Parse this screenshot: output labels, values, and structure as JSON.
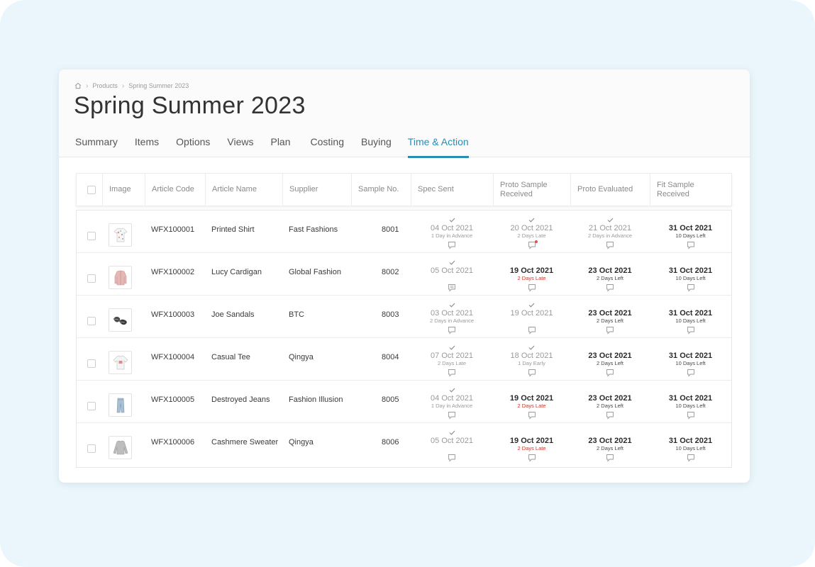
{
  "breadcrumb": [
    "Products",
    "Spring Summer 2023"
  ],
  "page_title": "Spring Summer 2023",
  "tabs": [
    {
      "label": "Summary",
      "active": false
    },
    {
      "label": "Items",
      "active": false
    },
    {
      "label": "Options",
      "active": false
    },
    {
      "label": "Views",
      "active": false
    },
    {
      "label": "Plan",
      "active": false
    },
    {
      "label": "Costing",
      "active": false
    },
    {
      "label": "Buying",
      "active": false
    },
    {
      "label": "Time & Action",
      "active": true
    }
  ],
  "columns": {
    "image": "Image",
    "article_code": "Article Code",
    "article_name": "Article Name",
    "supplier": "Supplier",
    "sample_no": "Sample No.",
    "spec_sent": "Spec Sent",
    "proto_received": "Proto Sample\nReceived",
    "proto_evaluated": "Proto Evaluated",
    "fit_received": "Fit Sample\nReceived"
  },
  "colors": {
    "accent": "#2a8cb5",
    "late": "#c0392b",
    "muted": "#9a9a9a"
  },
  "rows": [
    {
      "article_code": "WFX100001",
      "article_name": "Printed Shirt",
      "supplier": "Fast Fashions",
      "sample_no": "8001",
      "thumb_icon": "printed-shirt-icon",
      "spec": {
        "done": true,
        "date": "04 Oct 2021",
        "sub": "1 Day in Advance",
        "state": "done"
      },
      "proto": {
        "done": true,
        "date": "20 Oct 2021",
        "sub": "2 Days Late",
        "state": "done",
        "comment_alert": true
      },
      "eval": {
        "done": true,
        "date": "21 Oct 2021",
        "sub": "2 Days in Advance",
        "state": "done"
      },
      "fit": {
        "done": false,
        "date": "31 Oct 2021",
        "sub": "10 Days Left",
        "state": "pending"
      }
    },
    {
      "article_code": "WFX100002",
      "article_name": "Lucy Cardigan",
      "supplier": "Global Fashion",
      "sample_no": "8002",
      "thumb_icon": "cardigan-icon",
      "spec": {
        "done": true,
        "date": "05 Oct 2021",
        "sub": "",
        "state": "done"
      },
      "proto": {
        "done": false,
        "date": "19 Oct 2021",
        "sub": "2 Days Late",
        "state": "late"
      },
      "eval": {
        "done": false,
        "date": "23 Oct 2021",
        "sub": "2 Days Left",
        "state": "pending"
      },
      "fit": {
        "done": false,
        "date": "31 Oct 2021",
        "sub": "10 Days Left",
        "state": "pending"
      }
    },
    {
      "article_code": "WFX100003",
      "article_name": "Joe Sandals",
      "supplier": "BTC",
      "sample_no": "8003",
      "thumb_icon": "sandals-icon",
      "spec": {
        "done": true,
        "date": "03 Oct 2021",
        "sub": "2 Days in Advance",
        "state": "done"
      },
      "proto": {
        "done": true,
        "date": "19 Oct 2021",
        "sub": "",
        "state": "done"
      },
      "eval": {
        "done": false,
        "date": "23 Oct 2021",
        "sub": "2 Days Left",
        "state": "pending"
      },
      "fit": {
        "done": false,
        "date": "31 Oct 2021",
        "sub": "10 Days Left",
        "state": "pending"
      }
    },
    {
      "article_code": "WFX100004",
      "article_name": "Casual Tee",
      "supplier": "Qingya",
      "sample_no": "8004",
      "thumb_icon": "tee-icon",
      "spec": {
        "done": true,
        "date": "07 Oct 2021",
        "sub": "2 Days Late",
        "state": "done"
      },
      "proto": {
        "done": true,
        "date": "18 Oct 2021",
        "sub": "1 Day Early",
        "state": "done"
      },
      "eval": {
        "done": false,
        "date": "23 Oct 2021",
        "sub": "2 Days Left",
        "state": "pending"
      },
      "fit": {
        "done": false,
        "date": "31 Oct 2021",
        "sub": "10 Days Left",
        "state": "pending"
      }
    },
    {
      "article_code": "WFX100005",
      "article_name": "Destroyed Jeans",
      "supplier": "Fashion Illusion",
      "sample_no": "8005",
      "thumb_icon": "jeans-icon",
      "spec": {
        "done": true,
        "date": "04 Oct 2021",
        "sub": "1 Day in Advance",
        "state": "done"
      },
      "proto": {
        "done": false,
        "date": "19 Oct 2021",
        "sub": "2 Days Late",
        "state": "late"
      },
      "eval": {
        "done": false,
        "date": "23 Oct 2021",
        "sub": "2 Days Left",
        "state": "pending"
      },
      "fit": {
        "done": false,
        "date": "31 Oct 2021",
        "sub": "10 Days Left",
        "state": "pending"
      }
    },
    {
      "article_code": "WFX100006",
      "article_name": "Cashmere Sweater",
      "supplier": "Qingya",
      "sample_no": "8006",
      "thumb_icon": "sweater-icon",
      "spec": {
        "done": true,
        "date": "05 Oct 2021",
        "sub": "",
        "state": "done"
      },
      "proto": {
        "done": false,
        "date": "19 Oct 2021",
        "sub": "2 Days Late",
        "state": "late"
      },
      "eval": {
        "done": false,
        "date": "23 Oct 2021",
        "sub": "2 Days Left",
        "state": "pending"
      },
      "fit": {
        "done": false,
        "date": "31 Oct 2021",
        "sub": "10 Days Left",
        "state": "pending"
      }
    }
  ]
}
